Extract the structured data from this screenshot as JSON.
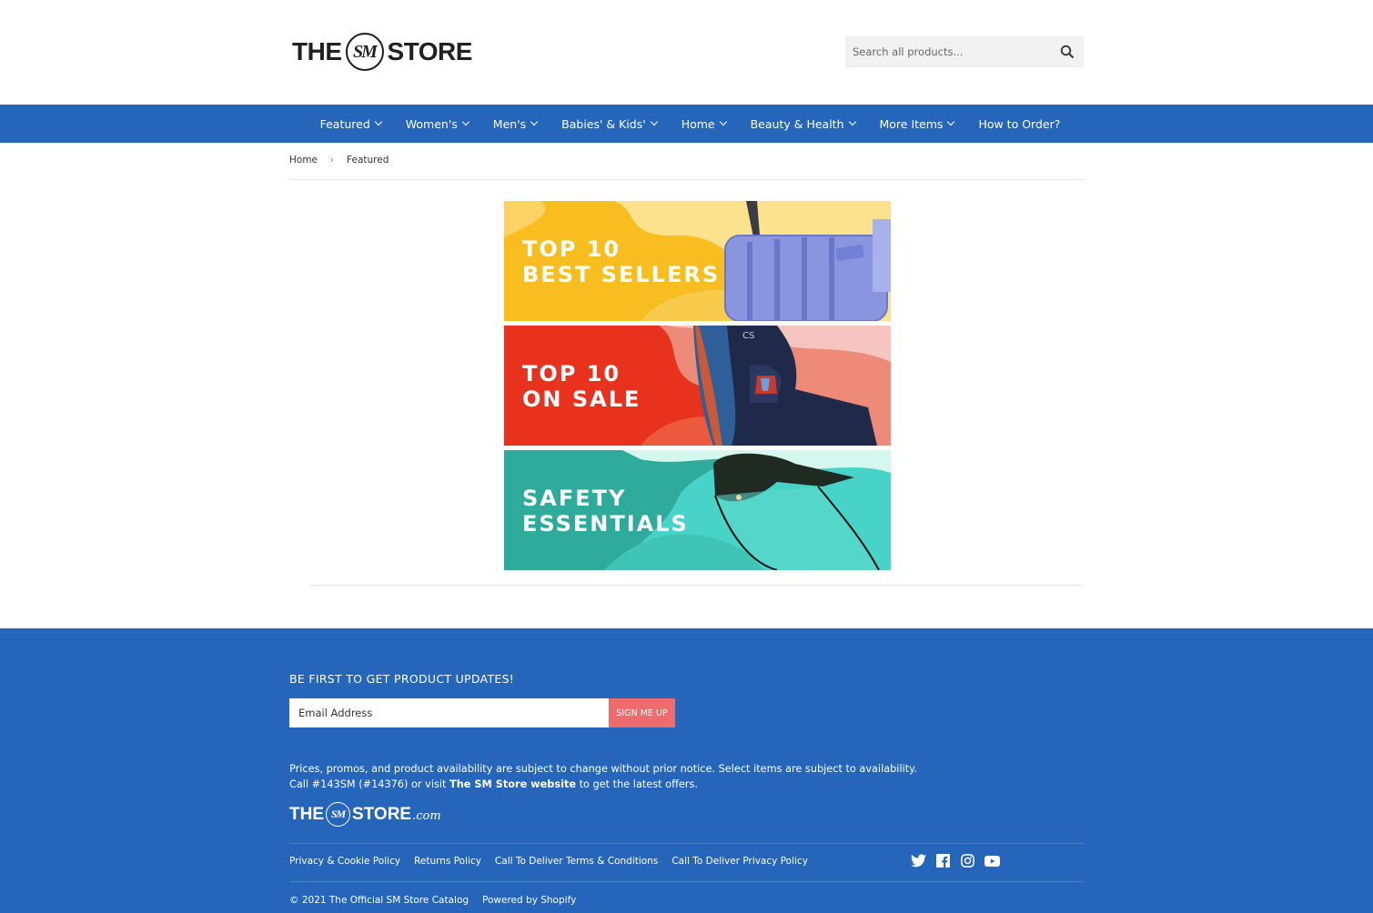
{
  "header": {
    "logo": {
      "left": "THE",
      "circle": "SM",
      "right": "STORE"
    },
    "search": {
      "placeholder": "Search all products...",
      "icon": "search-icon"
    }
  },
  "nav": {
    "items": [
      {
        "label": "Featured",
        "has_dropdown": true
      },
      {
        "label": "Women's",
        "has_dropdown": true
      },
      {
        "label": "Men's",
        "has_dropdown": true
      },
      {
        "label": "Babies' & Kids'",
        "has_dropdown": true
      },
      {
        "label": "Home",
        "has_dropdown": true
      },
      {
        "label": "Beauty & Health",
        "has_dropdown": true
      },
      {
        "label": "More Items",
        "has_dropdown": true
      },
      {
        "label": "How to Order?",
        "has_dropdown": false
      }
    ],
    "background": "#2566bb"
  },
  "breadcrumb": {
    "home": "Home",
    "separator": "›",
    "current": "Featured"
  },
  "banners": [
    {
      "line1": "TOP 10",
      "line2": "BEST SELLERS",
      "colors": [
        "#f8be1f",
        "#fde28e",
        "#8a95e0"
      ]
    },
    {
      "line1": "TOP 10",
      "line2": "ON SALE",
      "colors": [
        "#e8321d",
        "#f6c4c1",
        "#1f2a4a"
      ]
    },
    {
      "line1": "SAFETY",
      "line2": "ESSENTIALS",
      "colors": [
        "#2fab9b",
        "#d4f7ee",
        "#48d3c8"
      ]
    }
  ],
  "footer": {
    "heading": "BE FIRST TO GET PRODUCT UPDATES!",
    "email_placeholder": "Email Address",
    "signup_label": "SIGN ME UP",
    "notice_line1": "Prices, promos, and product availability are subject to change without prior notice. Select items are subject to availability.",
    "notice_line2_pre": "Call #143SM (#14376) or visit ",
    "notice_line2_link": "The SM Store website",
    "notice_line2_post": " to get the latest offers.",
    "logo": {
      "left": "THE",
      "circle": "SM",
      "right": "STORE",
      "suffix": ".com"
    },
    "links": [
      "Privacy & Cookie Policy",
      "Returns Policy",
      "Call To Deliver Terms & Conditions",
      "Call To Deliver Privacy Policy"
    ],
    "social": [
      "twitter-icon",
      "facebook-icon",
      "instagram-icon",
      "youtube-icon"
    ],
    "copyright": "© 2021 The Official SM Store Catalog",
    "powered": "Powered by Shopify",
    "accent": "#ee6b6e"
  }
}
